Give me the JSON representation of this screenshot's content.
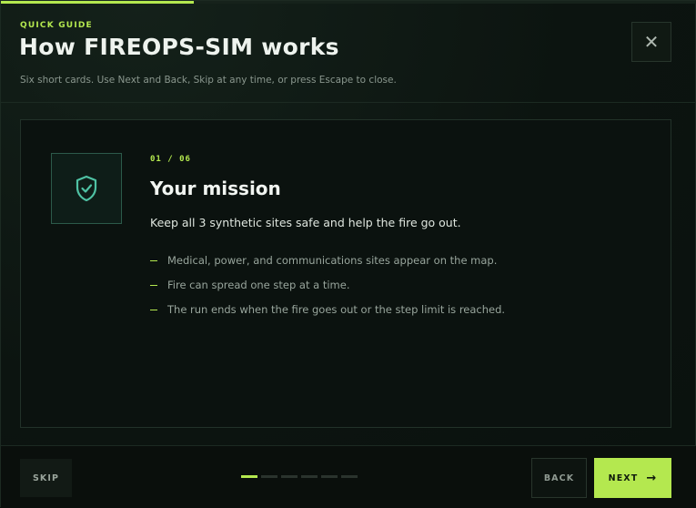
{
  "header": {
    "eyebrow": "QUICK GUIDE",
    "title": "How FIREOPS-SIM works",
    "subtitle": "Six short cards. Use Next and Back, Skip at any time, or press Escape to close.",
    "close_icon": "close-icon",
    "close_glyph": "✕"
  },
  "progress": {
    "fraction": 0.2767,
    "step": 1,
    "total": 6
  },
  "card": {
    "icon": "shield-check-icon",
    "counter": "01 / 06",
    "title": "Your mission",
    "lead": "Keep all 3 synthetic sites safe and help the fire go out.",
    "bullets": [
      "Medical, power, and communications sites appear on the map.",
      "Fire can spread one step at a time.",
      "The run ends when the fire goes out or the step limit is reached."
    ]
  },
  "footer": {
    "skip_label": "SKIP",
    "back_label": "BACK",
    "next_label": "NEXT",
    "next_icon": "arrow-right-icon",
    "dots": [
      true,
      false,
      false,
      false,
      false,
      false
    ]
  },
  "colors": {
    "accent": "#b4e84f",
    "icon_teal": "#4fc2a4",
    "background": "#0a100d"
  }
}
